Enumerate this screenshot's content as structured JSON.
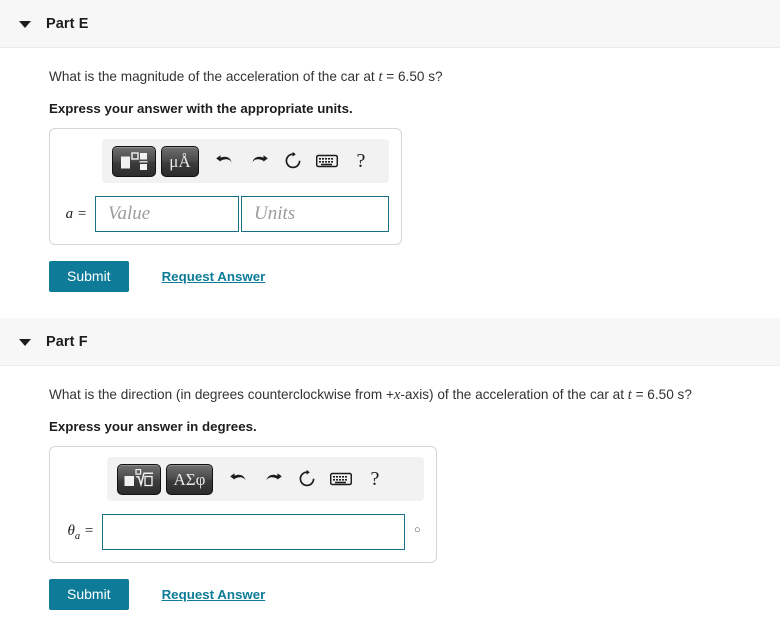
{
  "parts": [
    {
      "id": "part-e",
      "title": "Part E",
      "toggle_icon": "triangle-down-icon",
      "question_pre": "What is the magnitude of the acceleration of the car at ",
      "question_var": "t",
      "question_post": " = 6.50 s?",
      "instruction": "Express your answer with the appropriate units.",
      "toolbar": {
        "template_button_label": "math-template",
        "symbol_button_label": "μÅ",
        "undo_label": "undo-icon",
        "redo_label": "redo-icon",
        "reset_label": "reset-icon",
        "keyboard_label": "keyboard-icon",
        "help_label": "?"
      },
      "field_label_main": "a",
      "field_label_sub": "",
      "field_label_eq": " =",
      "value_placeholder": "Value",
      "value_current": "",
      "units_placeholder": "Units",
      "units_current": "",
      "submit_label": "Submit",
      "request_answer_label": "Request Answer"
    },
    {
      "id": "part-f",
      "title": "Part F",
      "toggle_icon": "triangle-down-icon",
      "question_pre": "What is the direction (in degrees counterclockwise from +",
      "question_var": "x",
      "question_mid": "-axis) of the acceleration of the car at ",
      "question_var2": "t",
      "question_post": " = 6.50 s?",
      "instruction": "Express your answer in degrees.",
      "toolbar": {
        "template_button_label": "math-template-root",
        "symbol_button_label": "ΑΣφ",
        "undo_label": "undo-icon",
        "redo_label": "redo-icon",
        "reset_label": "reset-icon",
        "keyboard_label": "keyboard-icon",
        "help_label": "?"
      },
      "field_label_main": "θ",
      "field_label_sub": "a",
      "field_label_eq": " =",
      "value_placeholder": "",
      "value_current": "",
      "unit_suffix": "○",
      "submit_label": "Submit",
      "request_answer_label": "Request Answer"
    }
  ],
  "colors": {
    "accent_teal": "#0e7c99",
    "input_border": "#1a6e85",
    "header_band": "#f7f7f7",
    "text": "#1d1d1d"
  }
}
